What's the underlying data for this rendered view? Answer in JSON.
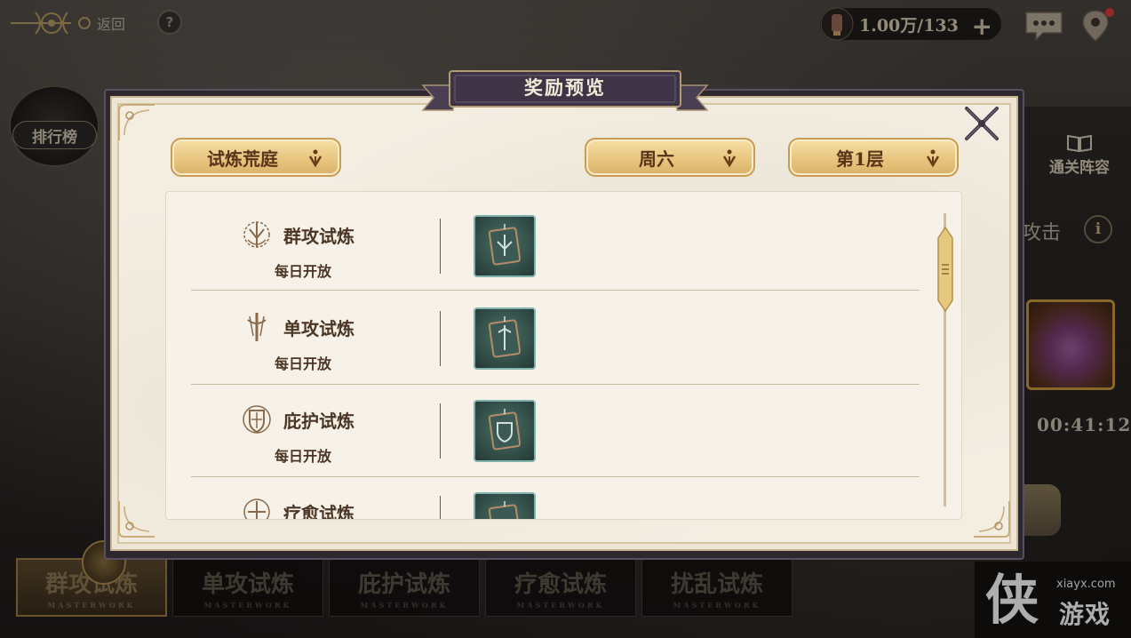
{
  "topbar": {
    "back_label": "返回",
    "help_label": "?",
    "currency_value": "1.00万/133",
    "currency_plus": "+"
  },
  "background": {
    "leaderboard_label": "排行榜",
    "pass_lineup_label": "通关阵容",
    "attack_partial": "攻击",
    "info_label": "i",
    "timer": "00:41:12"
  },
  "bottom_tabs": [
    {
      "label": "群攻试炼",
      "sub": "MASTERWORK",
      "active": true
    },
    {
      "label": "单攻试炼",
      "sub": "MASTERWORK",
      "active": false
    },
    {
      "label": "庇护试炼",
      "sub": "MASTERWORK",
      "active": false
    },
    {
      "label": "疗愈试炼",
      "sub": "MASTERWORK",
      "active": false
    },
    {
      "label": "扰乱试炼",
      "sub": "MASTERWORK",
      "active": false
    }
  ],
  "watermark": {
    "url": "xiayx.com",
    "name": "游戏"
  },
  "modal": {
    "title": "奖励预览",
    "filters": {
      "mode": "试炼荒庭",
      "day": "周六",
      "floor": "第1层"
    },
    "rows": [
      {
        "title": "群攻试炼",
        "subtitle": "每日开放",
        "icon": "aoe-crest-icon"
      },
      {
        "title": "单攻试炼",
        "subtitle": "每日开放",
        "icon": "single-sword-icon"
      },
      {
        "title": "庇护试炼",
        "subtitle": "每日开放",
        "icon": "shield-crest-icon"
      },
      {
        "title": "疗愈试炼",
        "subtitle": "",
        "icon": "heal-crest-icon"
      }
    ]
  },
  "colors": {
    "accent_gold": "#e8c57f",
    "text_brown": "#4b3524",
    "modal_bg": "#f3ede2",
    "title_bar": "#3d3446"
  }
}
